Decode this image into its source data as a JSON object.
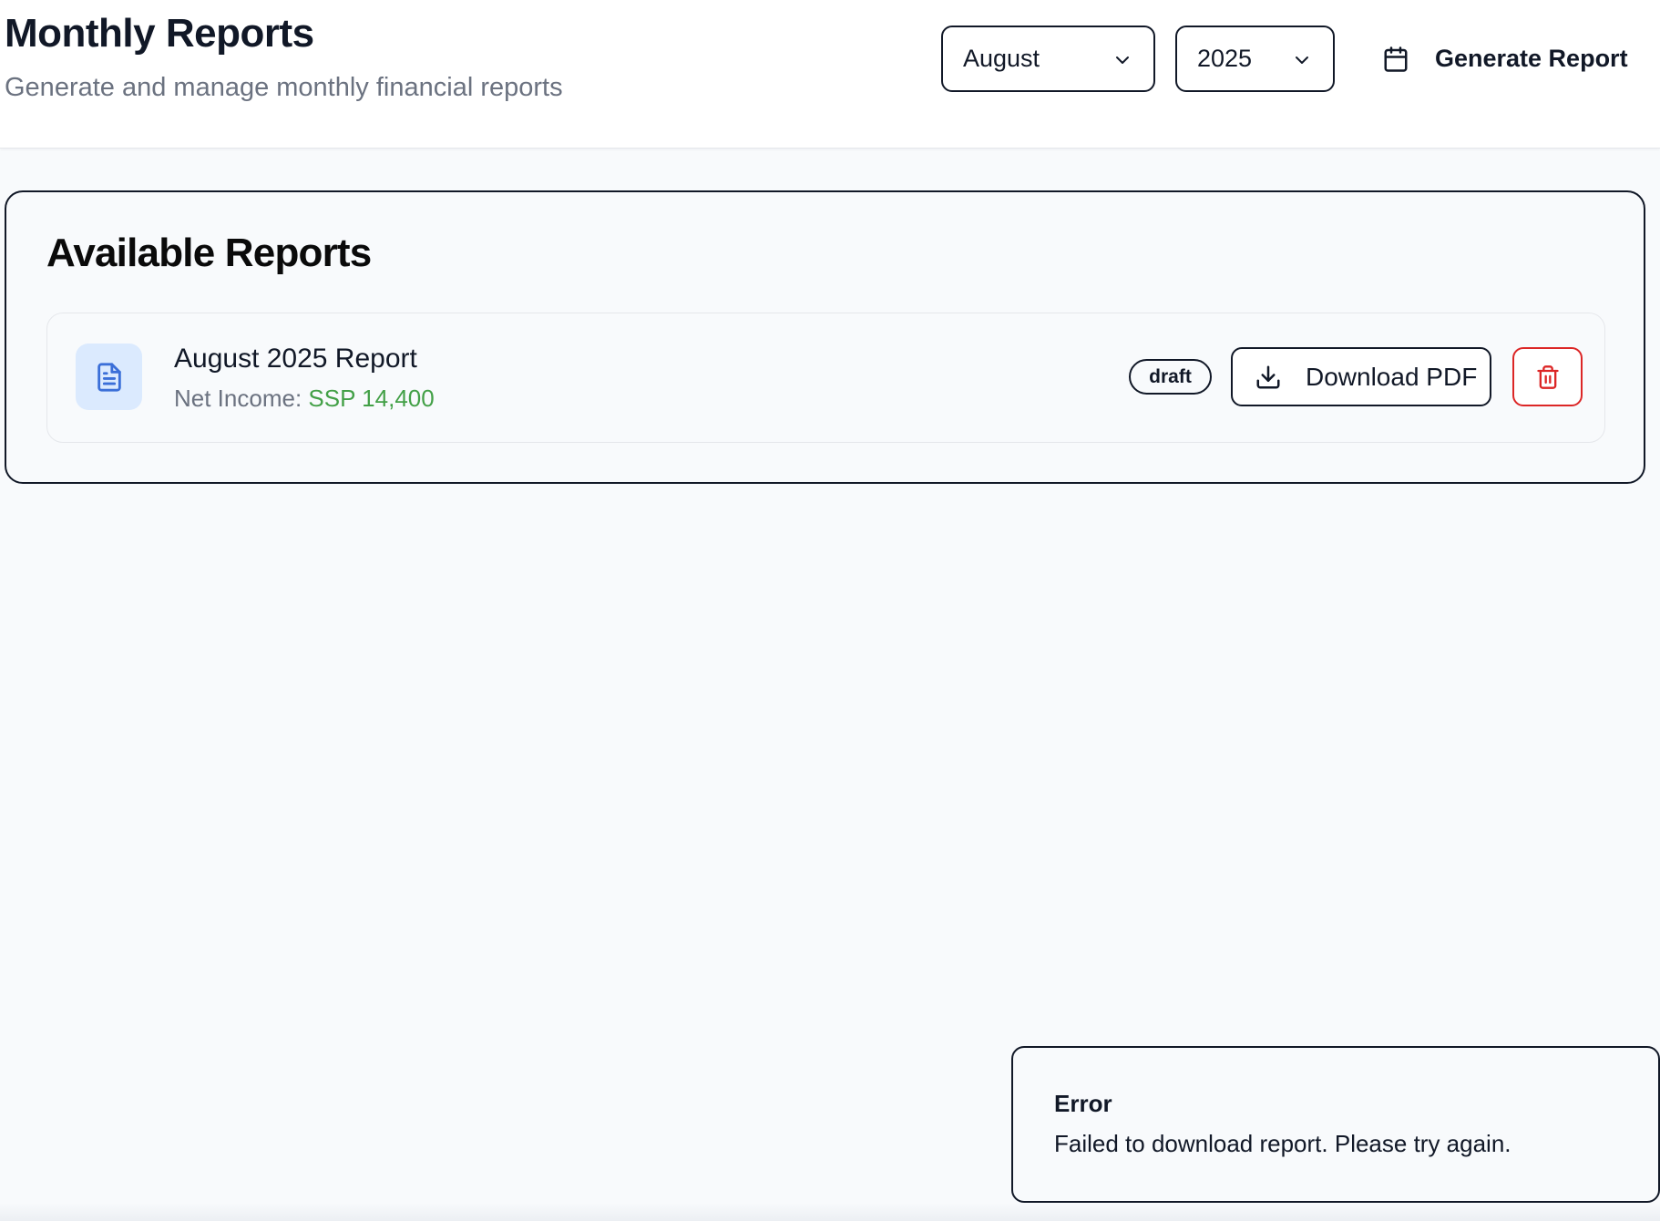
{
  "header": {
    "title": "Monthly Reports",
    "subtitle": "Generate and manage monthly financial reports",
    "month_select": {
      "value": "August",
      "icon": "chevron-down-icon"
    },
    "year_select": {
      "value": "2025",
      "icon": "chevron-down-icon"
    },
    "generate_button": {
      "label": "Generate Report",
      "icon": "calendar-icon"
    }
  },
  "reports_card": {
    "title": "Available Reports",
    "items": [
      {
        "name": "August 2025 Report",
        "net_income_label": "Net Income:",
        "net_income_value": "SSP 14,400",
        "status": "draft",
        "download_label": "Download PDF",
        "icons": {
          "file": "file-text-icon",
          "download": "download-icon",
          "delete": "trash-icon"
        }
      }
    ]
  },
  "toast": {
    "title": "Error",
    "message": "Failed to download report. Please try again."
  },
  "colors": {
    "background": "#f8fafc",
    "text": "#111827",
    "muted": "#6b7280",
    "income_green": "#43a047",
    "danger_red": "#dc2626",
    "doc_tile_bg": "#dbeafe",
    "doc_icon_blue": "#3b6fd8"
  }
}
